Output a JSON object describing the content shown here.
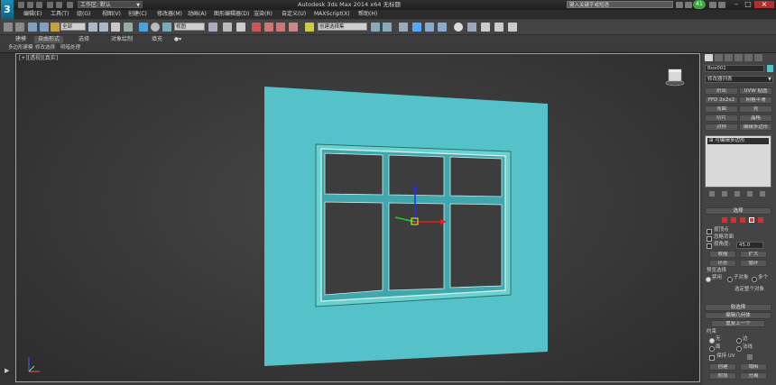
{
  "title_bar": {
    "logo": "3",
    "workspace": "工作区: 默认",
    "window_title": "Autodesk 3ds Max 2014 x64   无标题",
    "search_placeholder": "键入关键字或短语",
    "badge_count": "41"
  },
  "menu": [
    "编辑(E)",
    "工具(T)",
    "组(G)",
    "视图(V)",
    "创建(C)",
    "修改器(M)",
    "动画(A)",
    "图形编辑器(D)",
    "渲染(R)",
    "自定义(U)",
    "MAXScript(X)",
    "帮助(H)"
  ],
  "toolbar": {
    "filter_value": "全部",
    "refcoord_value": "视图",
    "selection_set_placeholder": "创建选择集"
  },
  "ribbon": {
    "tabs": [
      "建模",
      "自由形式",
      "选择",
      "对象绘制",
      "填充"
    ],
    "sub_items": [
      "多边形建模",
      "修改选择",
      "明暗处理"
    ]
  },
  "viewport": {
    "label": "[+][透视][真实]"
  },
  "command_panel": {
    "object_name": "Box001",
    "modifier_list": "修改器列表",
    "buttons": [
      [
        "挤出",
        "UVW 贴图"
      ],
      [
        "FFD 2x2x2",
        "网格平滑"
      ],
      [
        "弯曲",
        "壳"
      ],
      [
        "切片",
        "晶格"
      ],
      [
        "对称",
        "编辑多边形"
      ]
    ],
    "stack_item": "可编辑多边形",
    "selection_rollout": "选择",
    "by_vertex": "按顶点",
    "ignore_backfacing": "忽略背面",
    "by_angle": "按角度:",
    "angle_value": "45.0",
    "shrink": "收缩",
    "grow": "扩大",
    "ring": "环形",
    "loop": "循环",
    "preview_selection": "预览选择",
    "preview_options": [
      "禁用",
      "子对象",
      "多个"
    ],
    "selected_info": "选定整个对象",
    "soft_selection": "软选择",
    "edit_geometry": "编辑几何体",
    "repeat_last": "重复上一个",
    "constraints": "约束",
    "constraint_options": [
      "无",
      "边",
      "面",
      "法线"
    ],
    "preserve_uv": "保持 UV",
    "create": "创建",
    "collapse": "塌陷",
    "attach": "附加",
    "detach": "分离"
  },
  "colors": {
    "plane": "#55c1c9",
    "frame": "#6ad1cc",
    "viewport_border": "#c9a43a",
    "gizmo_x": "#d22",
    "gizmo_y": "#2c2",
    "gizmo_z": "#23d"
  }
}
